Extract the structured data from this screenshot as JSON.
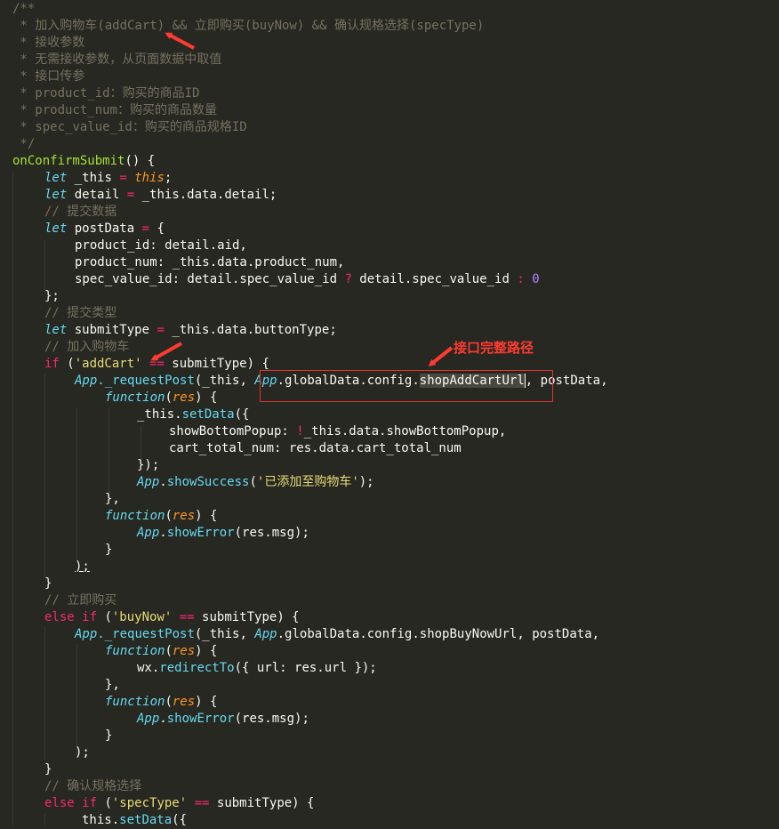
{
  "comment": {
    "open": "/**",
    "l1": " * 加入购物车(addCart) && 立即购买(buyNow) && 确认规格选择(specType)",
    "l2": " * 接收参数",
    "l3": " * 无需接收参数，从页面数据中取值",
    "l4": " * 接口传参",
    "l5": " * product_id：购买的商品ID",
    "l6": " * product_num：购买的商品数量",
    "l7": " * spec_value_id：购买的商品规格ID",
    "close": " */"
  },
  "code": {
    "fn_name": "onConfirmSubmit",
    "fn_tail": "() {",
    "kw_let": "let",
    "var_this": " _this ",
    "eq": "=",
    "this_kw": "this",
    "semi": ";",
    "var_detail": " detail ",
    "detail_val": " _this.data.detail;",
    "cmt_submit_data": "// 提交数据",
    "var_postData": " postData ",
    "brace_open": " {",
    "product_id_line": "product_id: detail.aid,",
    "product_num_line": "product_num: _this.data.product_num,",
    "spec_line_a": "spec_value_id: detail.spec_value_id ",
    "q": "?",
    "spec_line_b": " detail.spec_value_id ",
    "colon": ":",
    "zero": "0",
    "close_semi": "};",
    "cmt_submit_type": "// 提交类型",
    "var_submitType": " submitType ",
    "submitType_val": " _this.data.buttonType;",
    "cmt_add_cart": "// 加入购物车",
    "kw_if": "if",
    "paren_open": " (",
    "str_addCart": "'addCart'",
    "eqeq": "==",
    "submitType_tail": " submitType) {",
    "app": "App",
    "dot_requestPost": "._requestPost",
    "args_this": "(_this, ",
    "globalData_config": ".globalData.config.",
    "shopAddCartUrl": "shopAddCartUrl",
    "args_post": ", postData,",
    "kw_function": "function",
    "par_open": "(",
    "res": "res",
    "par_close_brace": ") {",
    "this_setData_a": "_this.",
    "setData": "setData",
    "setData_tail": "({",
    "showBottomPopup_a": "showBottomPopup: ",
    "bang": "!",
    "showBottomPopup_b": "_this.data.showBottomPopup,",
    "cart_total_line": "cart_total_num: res.data.cart_total_num",
    "close_paren_semi": "});",
    "dot": ".",
    "showSuccess": "showSuccess",
    "str_added": "'已添加至购物车'",
    "paren_semi": ");",
    "close_brace_comma": "},",
    "showError": "showError",
    "err_args": "(res.msg);",
    "close_brace": "}",
    "cmt_buy_now": "// 立即购买",
    "kw_else": "else",
    "str_buyNow": "'buyNow'",
    "shopBuyNowUrl_line": "shopBuyNowUrl, postData,",
    "wx_a": "wx.",
    "redirectTo": "redirectTo",
    "redirect_args": "({ url: res.url });",
    "cmt_spec": "// 确认规格选择",
    "str_specType": "'specType'",
    "last_a": "this.",
    "last_b": "({"
  },
  "annotation": {
    "label": "接口完整路径"
  },
  "colors": {
    "background": "#272822",
    "comment": "#75715e",
    "keyword": "#66d9ef",
    "operator": "#f92672",
    "string": "#e6db74",
    "number": "#ae81ff",
    "function": "#a6e22e",
    "parameter": "#fd971f",
    "annotation": "#ff3b30"
  }
}
